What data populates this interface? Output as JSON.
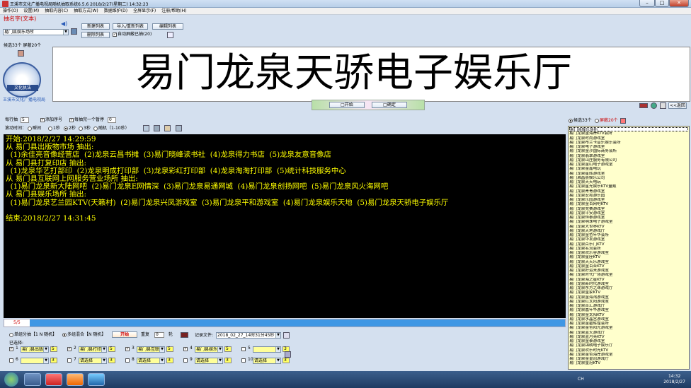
{
  "window": {
    "title": "王溪市文化广播电视局随机抽取系统6.5.6 2018/2/27(星期二) 14:32:23",
    "min": "–",
    "max": "□",
    "close": "✕"
  },
  "menu": [
    "操作(O)",
    "设置(M)",
    "抽取内容(C)",
    "抽取方式(W)",
    "数据维护(D)",
    "全屏显示(F)",
    "注册/帮助(H)"
  ],
  "left": {
    "heading": "抽名字(文本)",
    "category_select": "易门县娱乐场所",
    "buttons": {
      "new_list": "新建列表",
      "import": "导入/重新列表",
      "edit": "编辑列表",
      "delete": "删除列表"
    },
    "auto_mask": "自动屏蔽已抽(20)",
    "stats": "候选33个 屏蔽20个",
    "org": "王溪市文化广播电视局",
    "logo_text": "文化执法"
  },
  "big_title": "易门龙泉天骄电子娱乐厅",
  "center_buttons": {
    "start": "□开始",
    "confirm": "□确定"
  },
  "options": {
    "per_row_label": "每行抽",
    "per_row": "5",
    "add_seq": "添加序号",
    "pause_each": "每抽完一个暂停",
    "pause_val": "0",
    "interval_label": "滚动时间：",
    "interval_opts": [
      "瞬间",
      "1秒",
      "2秒",
      "3秒",
      "随机（1-10秒）"
    ]
  },
  "console": [
    "开始:2018/2/27 14:29:59",
    "从 易门县出版物市场 抽出:",
    "  (1)余佳亮音像经营店  (2)龙泉云昌书摊  (3)易门晓峰读书社  (4)龙泉得力书店  (5)龙泉友意音像店",
    "从 易门县打复印店 抽出:",
    "  (1)龙泉华艺打部印  (2)龙泉明成打印部  (3)龙泉彩红打印部  (4)龙泉淘淘打印部  (5)统计科技服务中心",
    "从 易门县互联网上网服务营业场所 抽出:",
    "  (1)易门龙泉新大陆网吧  (2)易门龙泉E网情深  (3)易门龙泉易通网城  (4)易门龙泉创扬网吧  (5)易门龙泉风火海网吧",
    "从 易门县娱乐场所 抽出:",
    "  (1)易门龙泉艺兰园KTV(天籁村)  (2)易门龙泉兴凤游戏室  (3)易门龙泉平和游戏室  (4)易门龙泉娱乐天地  (5)易门龙泉天骄电子娱乐厅",
    "",
    "结束:2018/2/27 14:31:45"
  ],
  "progress": {
    "label": "5/5",
    "fraction": 1.0
  },
  "right": {
    "cand": "候选33个",
    "mask": "屏蔽20个",
    "return": "<<返回",
    "items": [
      "易门县娱乐场所",
      "易门龙泉金海岸KTV会所",
      "易门龙泉时尚游戏室",
      "易门龙泉布兰卡音乐娱乐会所",
      "易门龙泉电子游戏室",
      "易门龙泉金沙国际商务会所",
      "易门龙泉翡翠游戏室",
      "易门龙泉山庄服务有限公司",
      "易门龙泉金山电子游戏室",
      "易门龙泉金鑫电玩",
      "易门龙泉星辉游戏室",
      "易门湘昌县娱乐公司",
      "易门龙泉天天电玩",
      "易门龙泉星光娱乐KTV量贩",
      "易门龙泉青青游戏室",
      "易门龙泉宏和游乐园",
      "易门龙泉乐园游戏室",
      "易门龙泉金百网吧KTV",
      "易门龙泉竞赛游戏室",
      "易门龙泉平安游戏室",
      "易门龙泉恒泰游戏室",
      "易门龙泉明珠电子游戏室",
      "易门龙泉大世界KTV",
      "易门龙泉天地游戏厅",
      "易门龙泉金色年华会所",
      "易门龙泉华发游戏室",
      "易门龙泉百乐门KTV",
      "易门龙泉名流会所",
      "易门龙泉欢乐谷游戏室",
      "易门龙泉星座KTV",
      "易门龙泉天天乐游戏室",
      "易门龙泉金百合KTV",
      "易门龙泉好运来游戏室",
      "易门龙泉时代广场游戏室",
      "易门龙泉海之星KTV",
      "易门龙泉新时代游戏室",
      "易门龙泉东方之珠游戏厅",
      "易门龙泉皇家KTV",
      "易门龙泉金海湾游戏室",
      "易门龙泉红太阳游戏室",
      "易门龙泉百汇游戏厅",
      "易门龙泉嘉年华游戏室",
      "易门龙泉金太阳KTV",
      "易门龙泉水晶宫游戏室",
      "易门龙泉金碧辉煌会所",
      "易门龙泉金色阳光游戏室",
      "易门龙泉蓝天游戏厅",
      "易门龙泉蓝月亮KTV",
      "易门龙泉金泰游戏室",
      "易门龙泉锦绣电子娱乐厅",
      "易门龙泉欢乐时光KTV",
      "易门龙泉金色海岸游戏室",
      "易门龙泉金皇冠游戏厅",
      "易门龙泉皇冠KTV"
    ]
  },
  "bottom": {
    "mode1": "单组分抽【1 N 随机】",
    "mode2": "多组混合【N 随机】",
    "start_small": "开始",
    "repeat_label": "重复",
    "repeat": "0",
    "rounds": "轮",
    "record_label": "记录文件:",
    "record": "2018_02_27_14时31分45秒",
    "selected": "已选择:",
    "groups": [
      {
        "n": "1",
        "name": "易门县出版",
        "count": "5",
        "checked": true
      },
      {
        "n": "2",
        "name": "易门县打印",
        "count": "5",
        "checked": true
      },
      {
        "n": "3",
        "name": "易门县互联",
        "count": "5",
        "checked": true
      },
      {
        "n": "4",
        "name": "易门县娱乐",
        "count": "5",
        "checked": true
      },
      {
        "n": "5",
        "name": "",
        "count": "3",
        "checked": false
      },
      {
        "n": "6",
        "name": "",
        "count": "3",
        "checked": false
      },
      {
        "n": "7",
        "name": "请选择",
        "count": "3",
        "checked": false
      },
      {
        "n": "8",
        "name": "请选择",
        "count": "3",
        "checked": false
      },
      {
        "n": "9",
        "name": "请选择",
        "count": "3",
        "checked": false
      },
      {
        "n": "10",
        "name": "请选择",
        "count": "3",
        "checked": false
      }
    ]
  },
  "clock": {
    "time": "14:32",
    "date": "2018/2/27"
  },
  "taskbar_lang": "CH"
}
